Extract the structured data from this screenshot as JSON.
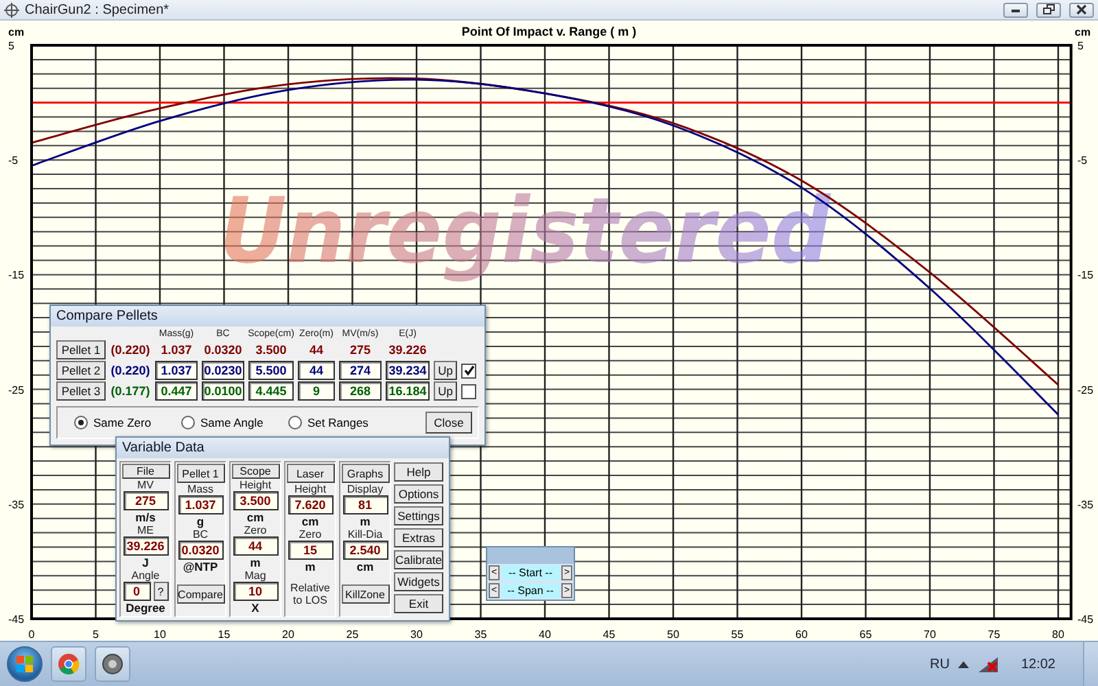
{
  "window": {
    "title": "ChairGun2 : Specimen*"
  },
  "chart": {
    "watermark": "Unregistered",
    "ylabel_right": "cm",
    "chart_data": {
      "type": "line",
      "title": "Point Of Impact v. Range ( m )",
      "ylabel": "cm",
      "x": [
        0,
        10,
        20,
        30,
        40,
        50,
        60,
        70,
        80
      ],
      "series": [
        {
          "color": "#800000",
          "values": [
            -3.5,
            -0.5,
            1.6,
            2.1,
            0.8,
            -1.8,
            -6.8,
            -14.8,
            -24.6
          ]
        },
        {
          "color": "#000080",
          "values": [
            -5.5,
            -1.6,
            1.1,
            2.0,
            0.8,
            -2.0,
            -7.4,
            -16.2,
            -27.2
          ]
        }
      ],
      "xlim": [
        0,
        81
      ],
      "ylim": [
        -45,
        5
      ],
      "xticks": [
        0,
        5,
        10,
        15,
        20,
        25,
        30,
        35,
        40,
        45,
        50,
        55,
        60,
        65,
        70,
        75,
        80
      ],
      "yticks": [
        5,
        -5,
        -15,
        -25,
        -35,
        -45
      ],
      "grid": true,
      "ref_lines": [
        {
          "axis": "y",
          "value": 0,
          "color": "#ff0000"
        }
      ]
    },
    "left_tick_labels": [
      "5",
      "-5",
      "-15",
      "-25",
      "-35",
      "-45"
    ]
  },
  "compare_pellets": {
    "title": "Compare Pellets",
    "columns": [
      "Mass(g)",
      "BC",
      "Scope(cm)",
      "Zero(m)",
      "MV(m/s)",
      "E(J)"
    ],
    "pellets": [
      {
        "label": "Pellet 1",
        "caliber": "(0.220)",
        "values": [
          "1.037",
          "0.0320",
          "3.500",
          "44",
          "275",
          "39.226"
        ],
        "color": "#800000",
        "kind": "fixed"
      },
      {
        "label": "Pellet 2",
        "caliber": "(0.220)",
        "values": [
          "1.037",
          "0.0230",
          "5.500",
          "44",
          "274",
          "39.234"
        ],
        "color": "#000080",
        "kind": "editable",
        "up": "Up",
        "checked": true
      },
      {
        "label": "Pellet 3",
        "caliber": "(0.177)",
        "values": [
          "0.447",
          "0.0100",
          "4.445",
          "9",
          "268",
          "16.184"
        ],
        "color": "#006000",
        "kind": "editable",
        "up": "Up",
        "checked": false
      }
    ],
    "modes": [
      {
        "label": "Same Zero",
        "selected": true
      },
      {
        "label": "Same Angle",
        "selected": false
      },
      {
        "label": "Set Ranges",
        "selected": false
      }
    ],
    "close": "Close"
  },
  "variable_data": {
    "title": "Variable Data",
    "columns": [
      {
        "items": [
          {
            "kind": "button",
            "text": "File"
          },
          {
            "kind": "label",
            "text": "MV"
          },
          {
            "kind": "field",
            "text": "275"
          },
          {
            "kind": "unit",
            "text": "m/s"
          },
          {
            "kind": "label",
            "text": "ME"
          },
          {
            "kind": "field",
            "text": "39.226"
          },
          {
            "kind": "unit",
            "text": "J"
          },
          {
            "kind": "label",
            "text": "Angle"
          },
          {
            "kind": "field_help",
            "text": "0",
            "help": "?"
          },
          {
            "kind": "unit",
            "text": "Degree"
          }
        ]
      },
      {
        "items": [
          {
            "kind": "button",
            "text": "Pellet 1"
          },
          {
            "kind": "label",
            "text": "Mass"
          },
          {
            "kind": "field",
            "text": "1.037"
          },
          {
            "kind": "unit",
            "text": "g"
          },
          {
            "kind": "label",
            "text": "BC"
          },
          {
            "kind": "field",
            "text": "0.0320"
          },
          {
            "kind": "unit",
            "text": "@NTP"
          },
          {
            "kind": "button",
            "text": "Compare"
          }
        ]
      },
      {
        "items": [
          {
            "kind": "button",
            "text": "Scope"
          },
          {
            "kind": "label",
            "text": "Height"
          },
          {
            "kind": "field",
            "text": "3.500"
          },
          {
            "kind": "unit",
            "text": "cm"
          },
          {
            "kind": "label",
            "text": "Zero"
          },
          {
            "kind": "field",
            "text": "44"
          },
          {
            "kind": "unit",
            "text": "m"
          },
          {
            "kind": "label",
            "text": "Mag"
          },
          {
            "kind": "field",
            "text": "10"
          },
          {
            "kind": "unit",
            "text": "X"
          }
        ]
      },
      {
        "items": [
          {
            "kind": "button",
            "text": "Laser"
          },
          {
            "kind": "label",
            "text": "Height"
          },
          {
            "kind": "field",
            "text": "7.620"
          },
          {
            "kind": "unit",
            "text": "cm"
          },
          {
            "kind": "label",
            "text": "Zero"
          },
          {
            "kind": "field",
            "text": "15"
          },
          {
            "kind": "unit",
            "text": "m"
          },
          {
            "kind": "note",
            "text": "Relative to LOS"
          }
        ]
      },
      {
        "items": [
          {
            "kind": "button",
            "text": "Graphs"
          },
          {
            "kind": "label",
            "text": "Display"
          },
          {
            "kind": "field",
            "text": "81"
          },
          {
            "kind": "unit",
            "text": "m"
          },
          {
            "kind": "label",
            "text": "Kill-Dia"
          },
          {
            "kind": "field",
            "text": "2.540"
          },
          {
            "kind": "unit",
            "text": "cm"
          },
          {
            "kind": "button",
            "text": "KillZone"
          }
        ]
      }
    ],
    "side_buttons": [
      "Help",
      "Options",
      "Settings",
      "Extras",
      "Calibrate",
      "Widgets",
      "Exit"
    ]
  },
  "range_widget": {
    "rows": [
      {
        "label": "-- Start --",
        "prev": "<",
        "next": ">"
      },
      {
        "label": "-- Span --",
        "prev": "<",
        "next": ">"
      }
    ]
  },
  "taskbar": {
    "language": "RU",
    "clock": "12:02"
  }
}
